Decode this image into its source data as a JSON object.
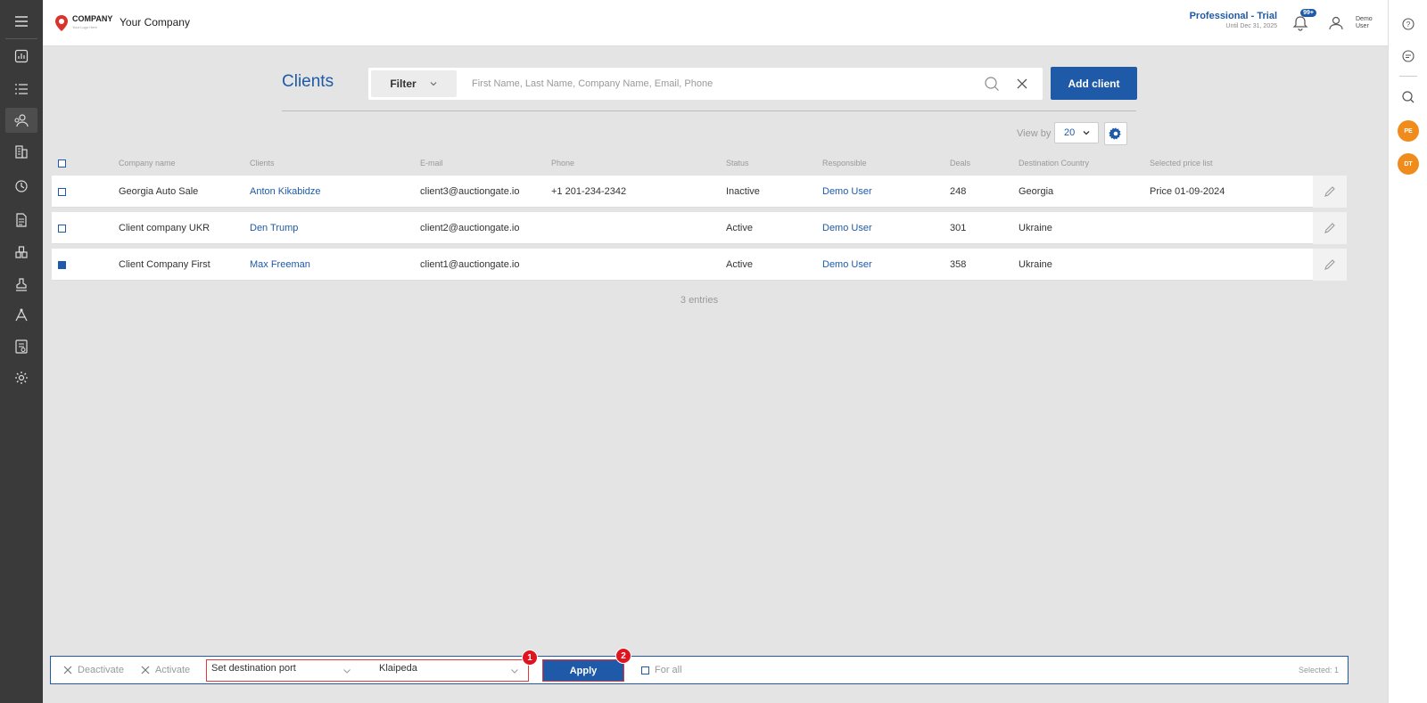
{
  "header": {
    "logo_text": "COMPANY",
    "logo_sub": "Your Logo Here",
    "company_name": "Your Company",
    "plan_name": "Professional - Trial",
    "plan_until": "Until Dec 31, 2025",
    "notifications_badge": "99+",
    "user_name": "Demo User"
  },
  "sidebar": {
    "items": [
      {
        "icon": "menu-icon"
      },
      {
        "icon": "dashboard-icon"
      },
      {
        "icon": "list-icon"
      },
      {
        "icon": "clients-icon",
        "active": true
      },
      {
        "icon": "buildings-icon"
      },
      {
        "icon": "sync-icon"
      },
      {
        "icon": "document-icon"
      },
      {
        "icon": "warehouse-icon"
      },
      {
        "icon": "stamp-icon"
      },
      {
        "icon": "network-icon"
      },
      {
        "icon": "reports-icon"
      },
      {
        "icon": "settings-icon"
      }
    ]
  },
  "rightrail": {
    "avatars": [
      "PE",
      "DT"
    ]
  },
  "page": {
    "title": "Clients",
    "filter_label": "Filter",
    "search_placeholder": "First Name, Last Name, Company Name, Email, Phone",
    "search_value": "",
    "add_button": "Add client",
    "view_by_label": "View by",
    "view_by_value": "20"
  },
  "table": {
    "columns": [
      "Company name",
      "Clients",
      "E-mail",
      "Phone",
      "Status",
      "Responsible",
      "Deals",
      "Destination Country",
      "Selected price list"
    ],
    "rows": [
      {
        "company": "Georgia Auto Sale",
        "client": "Anton Kikabidze",
        "email": "client3@auctiongate.io",
        "phone": "+1 201-234-2342",
        "status": "Inactive",
        "responsible": "Demo User",
        "deals": "248",
        "country": "Georgia",
        "price_list": "Price 01-09-2024",
        "checked": false
      },
      {
        "company": "Client company UKR",
        "client": "Den Trump",
        "email": "client2@auctiongate.io",
        "phone": "",
        "status": "Active",
        "responsible": "Demo User",
        "deals": "301",
        "country": "Ukraine",
        "price_list": "",
        "checked": false
      },
      {
        "company": "Client Company First",
        "client": "Max Freeman",
        "email": "client1@auctiongate.io",
        "phone": "",
        "status": "Active",
        "responsible": "Demo User",
        "deals": "358",
        "country": "Ukraine",
        "price_list": "",
        "checked": true
      }
    ],
    "entries_text": "3 entries"
  },
  "actionbar": {
    "deactivate": "Deactivate",
    "activate": "Activate",
    "action_select": "Set destination port",
    "value_select": "Klaipeda",
    "apply": "Apply",
    "badge1": "1",
    "badge2": "2",
    "for_all": "For all",
    "selected": "Selected: 1"
  },
  "colors": {
    "accent": "#1e5aa8",
    "sidebar": "#3a3a3a",
    "avatar": "#f08c1c",
    "highlight": "#e23a3a"
  }
}
